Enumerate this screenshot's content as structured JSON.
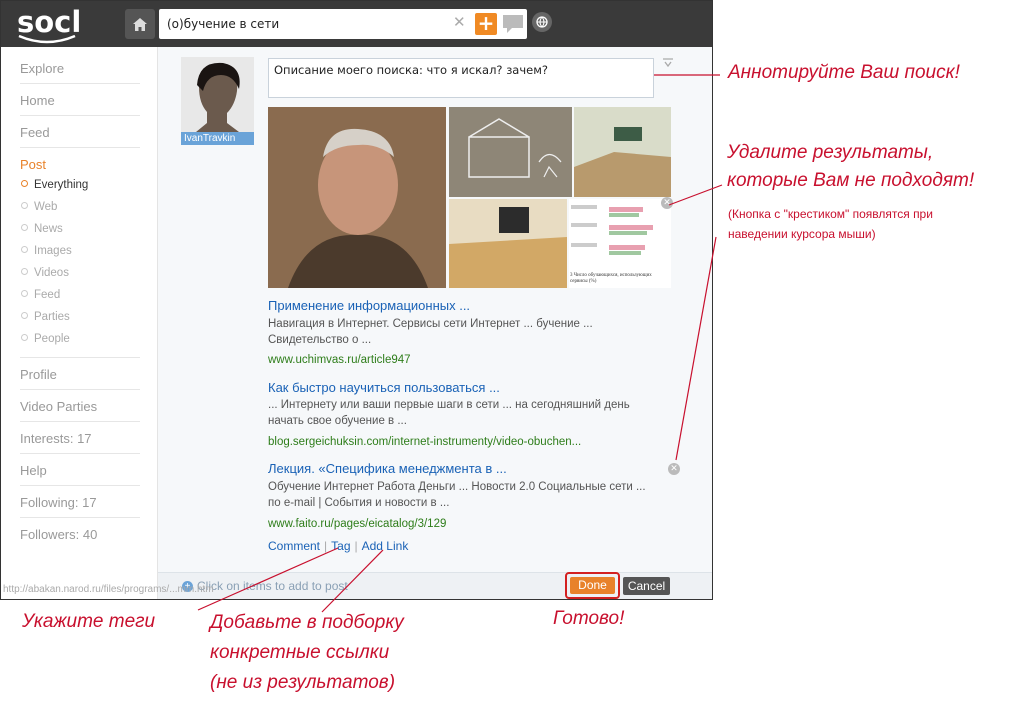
{
  "app": {
    "logo": "socl"
  },
  "search": {
    "query": "(о)бучение в сети"
  },
  "sidebar": {
    "explore": "Explore",
    "home": "Home",
    "feed": "Feed",
    "post": "Post",
    "sub": [
      "Everything",
      "Web",
      "News",
      "Images",
      "Videos",
      "Feed",
      "Parties",
      "People"
    ],
    "profile": "Profile",
    "video_parties": "Video Parties",
    "interests": "Interests: 17",
    "help": "Help",
    "following": "Following: 17",
    "followers": "Followers: 40"
  },
  "user": {
    "name": "IvanTravkin"
  },
  "annotation": {
    "text": "Описание моего поиска: что я искал? зачем?"
  },
  "thumb_texts": {
    "chart_caption": "3 Число обучающихся, использующих сервисы (%)"
  },
  "results": [
    {
      "title": "Применение информационных ...",
      "desc1": "Навигация в Интернет. Сервисы сети Интернет ... бучение ...",
      "desc2": "Свидетельство о ...",
      "url": "www.uchimvas.ru/article947"
    },
    {
      "title": "Как быстро научиться пользоваться ...",
      "desc1": "... Интернету или ваши первые шаги в сети ... на сегодняшний день",
      "desc2": "начать свое обучение в ...",
      "url": "blog.sergeichuksin.com/internet-instrumenty/video-obuchen..."
    },
    {
      "title": "Лекция. «Специфика менеджмента в ...",
      "desc1": "Обучение Интернет Работа Деньги ... Новости 2.0 Социальные сети ...",
      "desc2": "по e-mail | События и новости в ...",
      "url": "www.faito.ru/pages/eicatalog/3/129"
    }
  ],
  "actions": {
    "comment": "Comment",
    "tag": "Tag",
    "add_link": "Add Link"
  },
  "footer": {
    "hint": "Click on items to add to post",
    "done": "Done",
    "cancel": "Cancel",
    "status_url": "http://abakan.narod.ru/files/programs/...mm.htm"
  },
  "callouts": {
    "annotate": "Аннотируйте Ваш поиск!",
    "remove1": "Удалите результаты,",
    "remove2": "которые Вам не подходят!",
    "remove_note1": "(Кнопка с \"крестиком\" появлятся при",
    "remove_note2": "наведении курсора мыши)",
    "tags": "Укажите теги",
    "add_links1": "Добавьте в подборку",
    "add_links2": "конкретные ссылки",
    "add_links3": "(не из результатов)",
    "done": "Готово!"
  },
  "colors": {
    "accent": "#e8822a",
    "link": "#1a62b6",
    "url": "#2e7d1a",
    "callout": "#c8102e"
  }
}
